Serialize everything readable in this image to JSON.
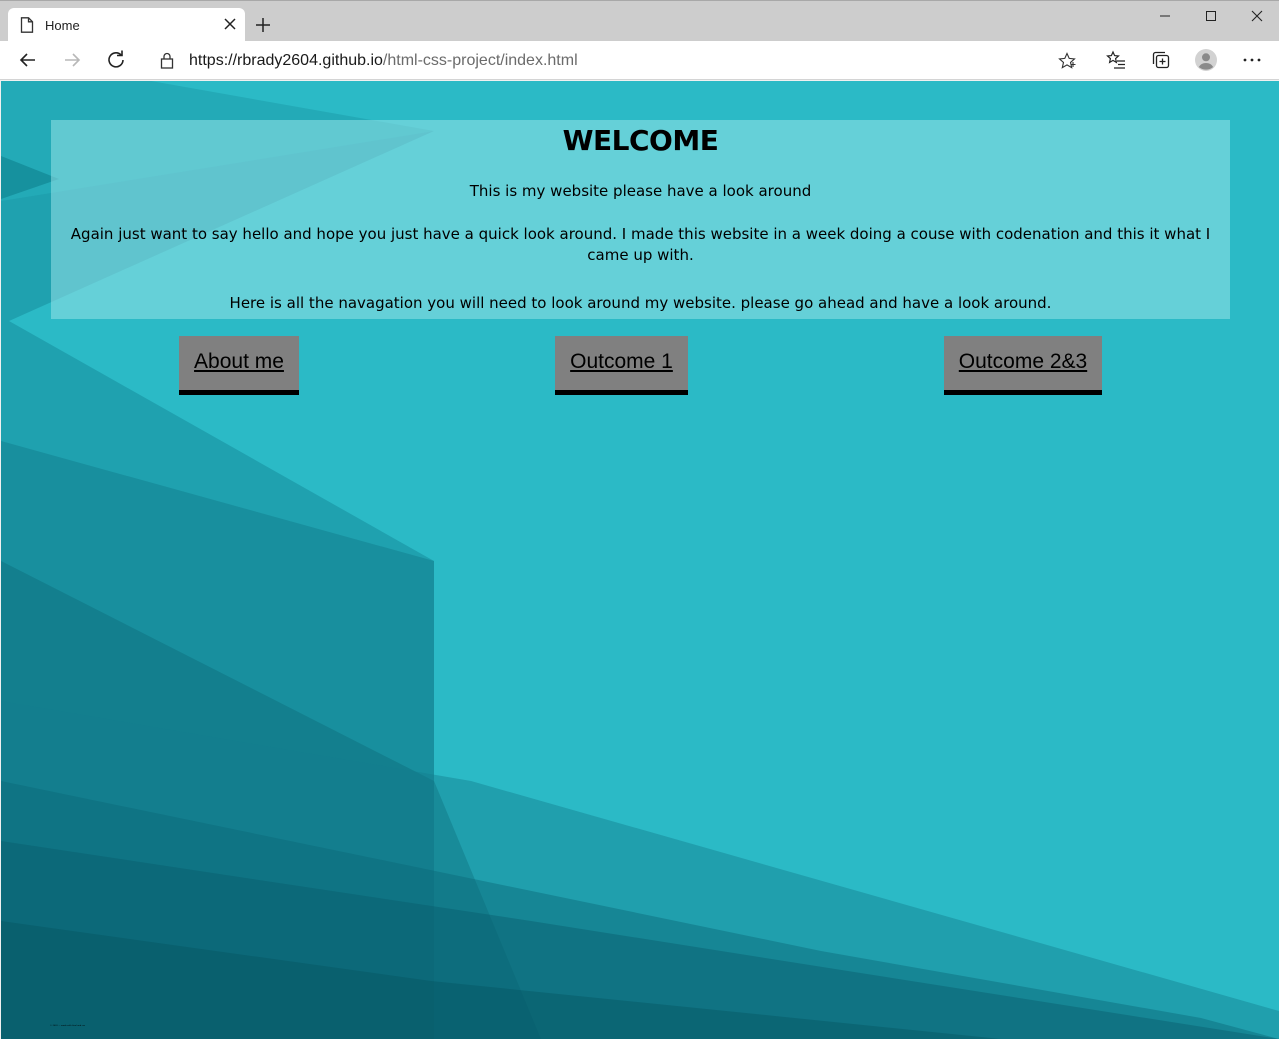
{
  "browser": {
    "tab": {
      "title": "Home"
    },
    "address": {
      "url_host": "https://rbrady2604.github.io",
      "url_path": "/html-css-project/index.html"
    }
  },
  "page": {
    "title": "WELCOME",
    "paragraphs": [
      "This is my website please have a look around",
      "Again just want to say hello and hope you just have a quick look around. I made this website in a week doing a couse with codenation and this it what I came up with.",
      "Here is all the navagation you will need to look around my website. please go ahead and have a look around."
    ],
    "nav": [
      {
        "label": "About me"
      },
      {
        "label": "Outcome 1"
      },
      {
        "label": "Outcome 2&3"
      }
    ],
    "footer": "© 2020 — made with html and css"
  },
  "colors": {
    "page_background": "#2bbac6",
    "nav_button": "#808080",
    "nav_border": "#000000"
  },
  "icons": {
    "tab": "page-icon",
    "close": "close-icon",
    "new_tab": "plus-icon",
    "back": "arrow-left-icon",
    "forward": "arrow-right-icon",
    "refresh": "refresh-icon",
    "lock": "lock-icon",
    "favorite": "star-icon",
    "favorites": "favorites-list-icon",
    "collections": "collections-icon",
    "profile": "avatar-icon",
    "menu": "ellipsis-icon"
  }
}
